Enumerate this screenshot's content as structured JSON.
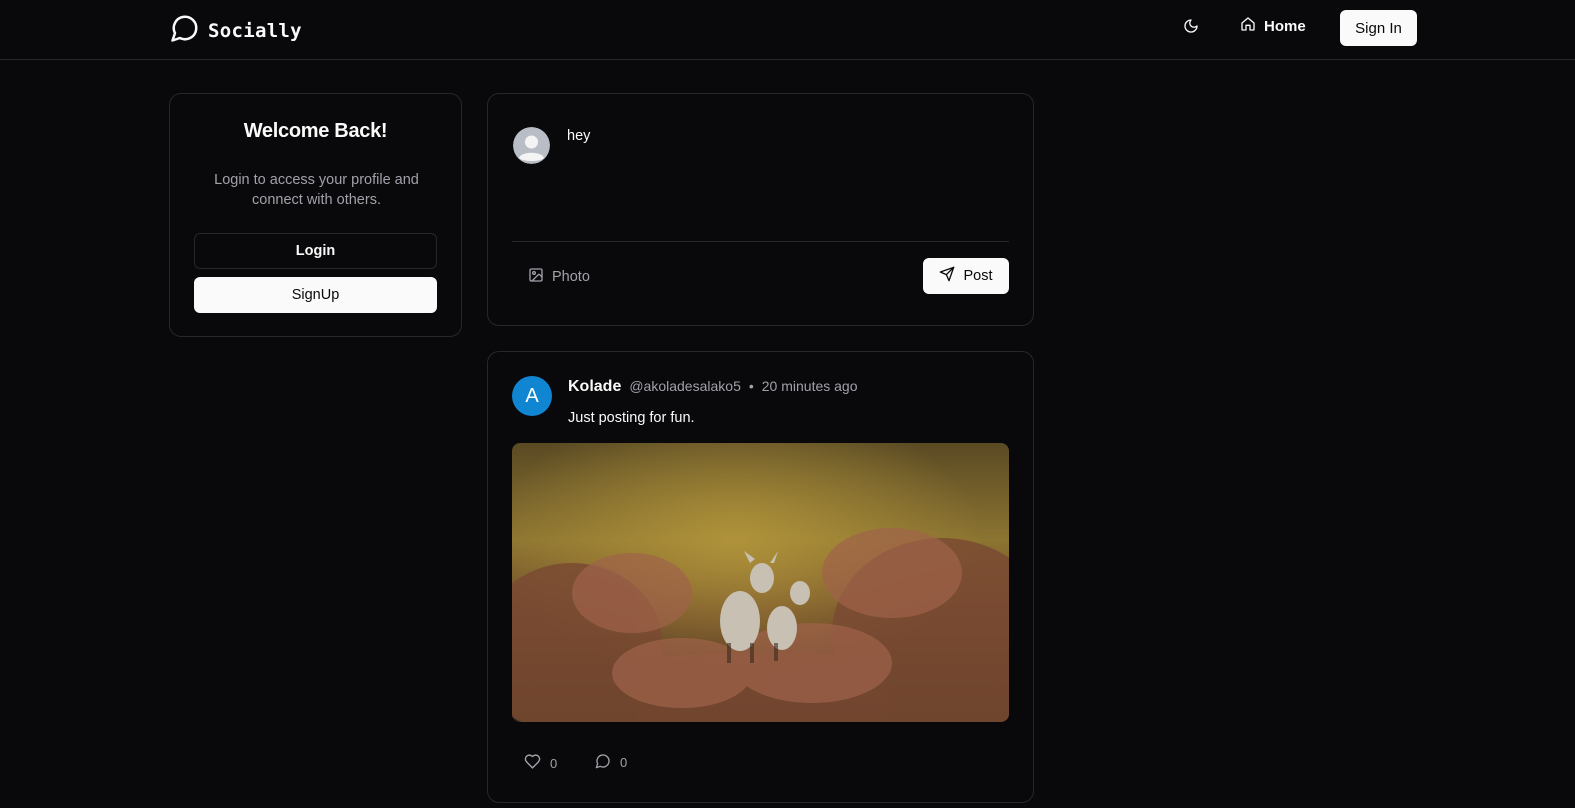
{
  "nav": {
    "brand": "Socially",
    "home_label": "Home",
    "signin_label": "Sign In",
    "icons": {
      "brand": "chat-bubble-icon",
      "theme": "moon-icon",
      "home": "home-icon"
    }
  },
  "welcome": {
    "title": "Welcome Back!",
    "description": "Login to access your profile and connect with others.",
    "login_label": "Login",
    "signup_label": "SignUp"
  },
  "composer": {
    "input_value": "hey",
    "photo_label": "Photo",
    "post_label": "Post",
    "icons": {
      "avatar": "user-avatar-icon",
      "photo": "image-icon",
      "post": "send-icon"
    }
  },
  "post": {
    "avatar_letter": "A",
    "author": "Kolade",
    "handle": "@akoladesalako5",
    "separator": "•",
    "time": "20 minutes ago",
    "content": "Just posting for fun.",
    "image_description": "two fawns standing among autumn ferns",
    "likes": "0",
    "comments": "0",
    "icons": {
      "like": "heart-icon",
      "comment": "comment-icon"
    }
  },
  "colors": {
    "background": "#09090b",
    "border": "#27272a",
    "foreground": "#fafafa",
    "muted": "#a1a1aa",
    "avatar_blue": "#1085d1"
  }
}
